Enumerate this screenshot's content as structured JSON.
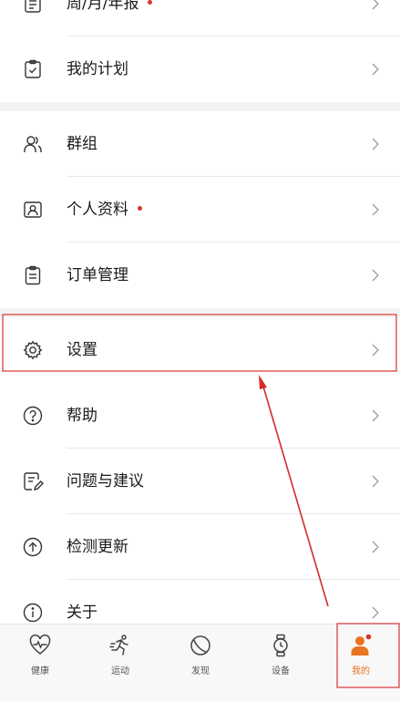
{
  "menu": {
    "items": [
      {
        "label": "周/月/年报",
        "dot": true,
        "icon": "report-icon"
      },
      {
        "label": "我的计划",
        "dot": false,
        "icon": "plan-icon"
      },
      {
        "label": "群组",
        "dot": false,
        "icon": "group-icon"
      },
      {
        "label": "个人资料",
        "dot": true,
        "icon": "profile-icon"
      },
      {
        "label": "订单管理",
        "dot": false,
        "icon": "order-icon"
      },
      {
        "label": "设置",
        "dot": false,
        "icon": "gear-icon"
      },
      {
        "label": "帮助",
        "dot": false,
        "icon": "help-icon"
      },
      {
        "label": "问题与建议",
        "dot": false,
        "icon": "feedback-icon"
      },
      {
        "label": "检测更新",
        "dot": false,
        "icon": "update-icon"
      },
      {
        "label": "关于",
        "dot": false,
        "icon": "info-icon"
      }
    ]
  },
  "tabbar": {
    "tabs": [
      {
        "label": "健康",
        "icon": "heart-pulse-icon",
        "active": false
      },
      {
        "label": "运动",
        "icon": "runner-icon",
        "active": false
      },
      {
        "label": "发现",
        "icon": "compass-icon",
        "active": false
      },
      {
        "label": "设备",
        "icon": "watch-icon",
        "active": false
      },
      {
        "label": "我的",
        "icon": "person-icon",
        "active": true
      }
    ]
  },
  "colors": {
    "accent": "#e8741f",
    "badge": "#d8362a",
    "highlight_box": "#e05a5a",
    "arrow": "#d42a2a"
  }
}
